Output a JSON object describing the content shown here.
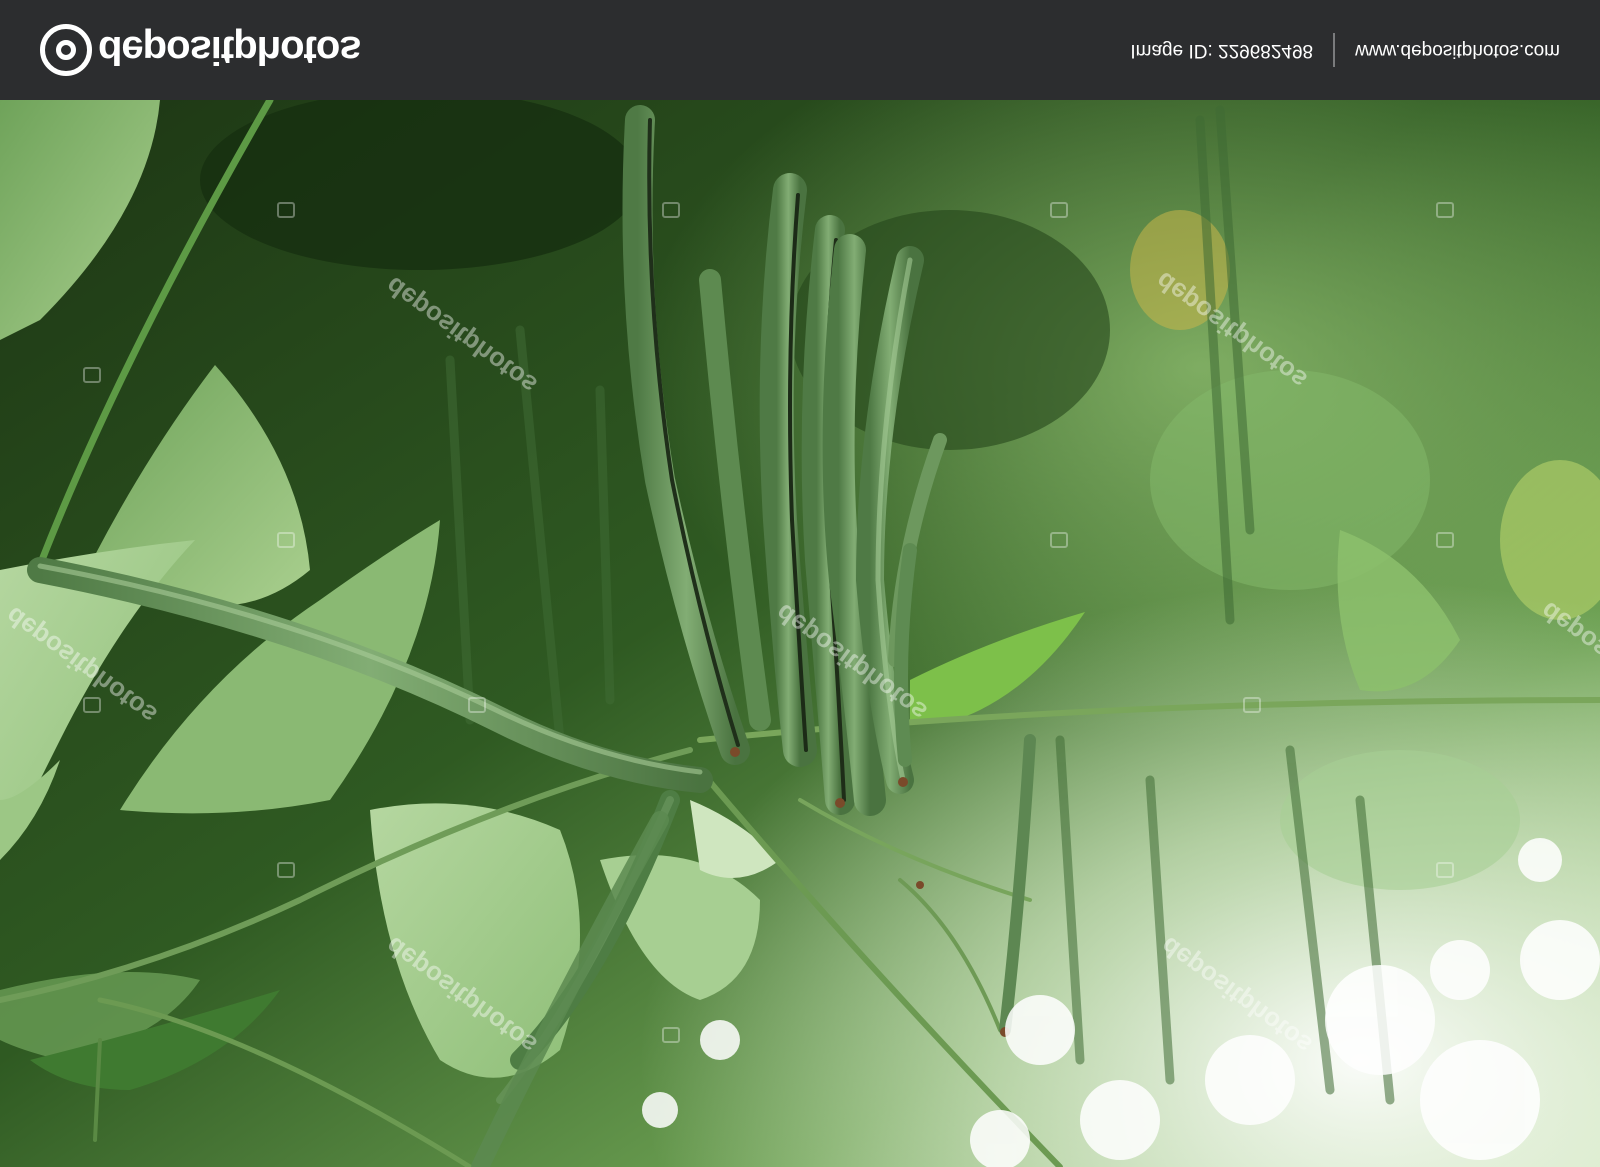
{
  "header": {
    "logo_text": "depositphotos",
    "image_id": "Image ID: 229682498",
    "site_url": "www.depositphotos.com"
  },
  "watermark": {
    "text": "depositphotos"
  },
  "colors": {
    "header_bg": "#2c2d2f",
    "foliage_dark": "#1f3a16",
    "foliage_mid": "#4f8a3a",
    "pod": "#6f9c63",
    "highlight": "#f1f6ea"
  }
}
